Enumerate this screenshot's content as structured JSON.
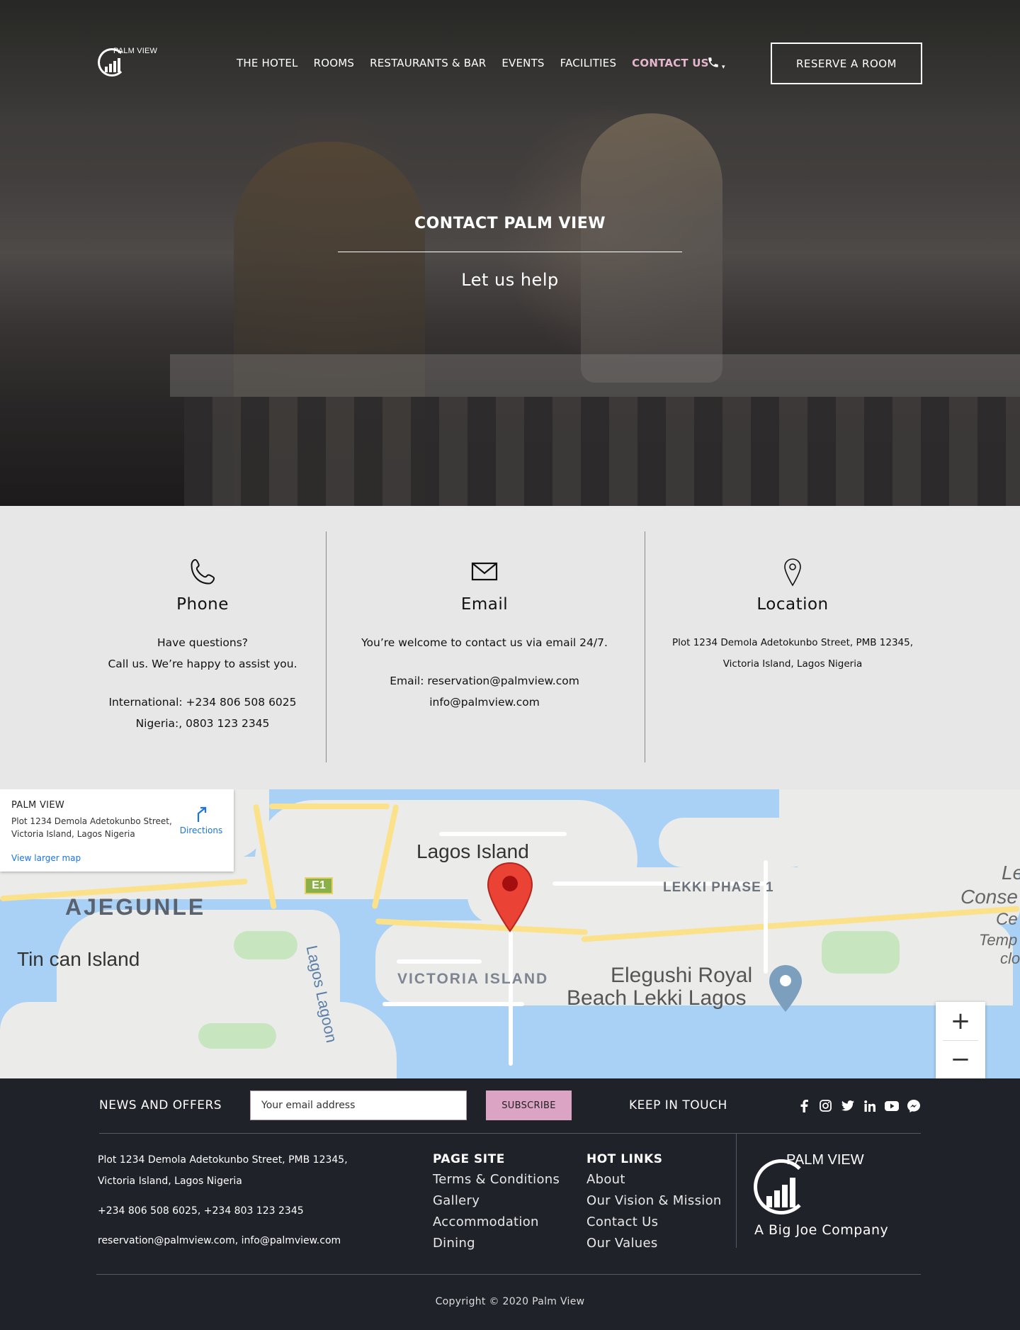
{
  "brand": {
    "name": "PALM VIEW"
  },
  "nav": {
    "items": [
      {
        "label": "THE HOTEL"
      },
      {
        "label": "ROOMS"
      },
      {
        "label": "RESTAURANTS & BAR"
      },
      {
        "label": "EVENTS"
      },
      {
        "label": "FACILITIES"
      },
      {
        "label": "CONTACT US",
        "active": true
      }
    ],
    "phone_icon": "phone-icon",
    "reserve_label": "RESERVE A ROOM"
  },
  "hero": {
    "title": "CONTACT PALM VIEW",
    "subtitle": "Let us help"
  },
  "contact": {
    "phone": {
      "icon": "phone-icon",
      "title": "Phone",
      "line1": "Have questions?",
      "line2": "Call us. We’re happy to assist you.",
      "international": "International: +234 806 508 6025",
      "nigeria": "Nigeria:, 0803 123 2345"
    },
    "email": {
      "icon": "envelope-icon",
      "title": "Email",
      "line1": "You’re welcome to contact us via email 24/7.",
      "email1": "Email: reservation@palmview.com",
      "email2": "info@palmview.com"
    },
    "location": {
      "icon": "map-pin-icon",
      "title": "Location",
      "line1": "Plot 1234 Demola Adetokunbo Street, PMB 12345,",
      "line2": "Victoria Island, Lagos Nigeria"
    }
  },
  "map": {
    "info": {
      "title": "PALM VIEW",
      "address1": "Plot 1234 Demola Adetokunbo Street,",
      "address2": "Victoria Island, Lagos Nigeria",
      "directions": "Directions",
      "larger_map": "View larger map"
    },
    "labels": {
      "lagos_island": "Lagos Island",
      "ajegunle": "AJEGUNLE",
      "tin_can": "Tin can Island",
      "lagos_lagoon": "Lagos Lagoon",
      "victoria_island": "VICTORIA ISLAND",
      "lekki": "LEKKI PHASE 1",
      "elegushi1": "Elegushi Royal",
      "elegushi2": "Beach Lekki Lagos",
      "e1": "E1",
      "edge1": "Le",
      "edge2": "Conse",
      "edge3": "Ce",
      "edge4": "Temp",
      "edge5": "clo"
    },
    "zoom_in": "+",
    "zoom_out": "−",
    "colors": {
      "water": "#a8d1f5",
      "land": "#ebebe9",
      "highway": "#fbe18a",
      "pin": "#ea4335"
    }
  },
  "footer": {
    "news_label": "NEWS AND OFFERS",
    "email_placeholder": "Your email address",
    "subscribe_label": "SUBSCRIBE",
    "keep_label": "KEEP IN TOUCH",
    "socials": [
      "facebook-icon",
      "instagram-icon",
      "twitter-icon",
      "linkedin-icon",
      "youtube-icon",
      "messenger-icon"
    ],
    "address1": "Plot 1234 Demola Adetokunbo Street, PMB 12345,",
    "address2": "Victoria Island, Lagos Nigeria",
    "phones": "+234 806 508 6025, +234 803 123 2345",
    "emails": "reservation@palmview.com, info@palmview.com",
    "page_site": {
      "title": "PAGE SITE",
      "links": [
        "Terms & Conditions",
        "Gallery",
        "Accommodation",
        "Dining"
      ]
    },
    "hot_links": {
      "title": "HOT LINKS",
      "links": [
        "About",
        "Our Vision & Mission",
        "Contact Us",
        "Our Values"
      ]
    },
    "logo_name": "PALM VIEW",
    "company": "A Big Joe Company",
    "copyright": "Copyright © 2020 Palm View",
    "accent_color": "#dca4c4"
  }
}
